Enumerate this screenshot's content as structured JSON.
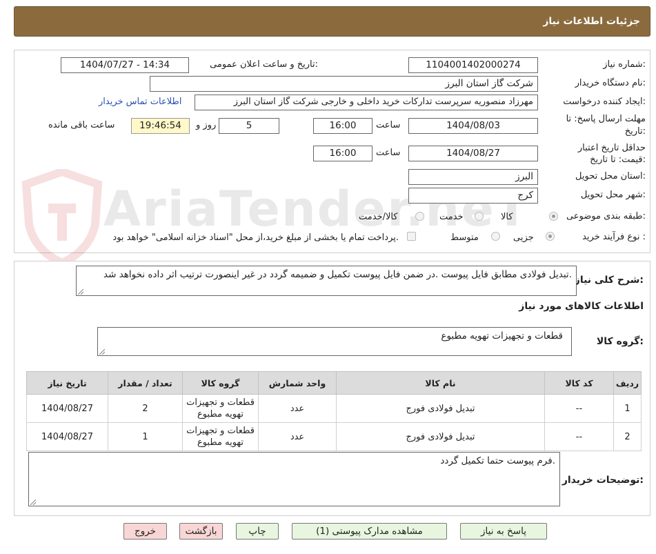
{
  "header": {
    "title": "جزئیات اطلاعات نیاز"
  },
  "details": {
    "need_number_label": "شماره نیاز:",
    "need_number": "1104001402000274",
    "announce_label": "تاریخ و ساعت اعلان عمومی:",
    "announce_value": "1404/07/27 - 14:34",
    "buyer_org_label": "نام دستگاه خریدار:",
    "buyer_org": "شرکت گاز استان البرز",
    "requester_label": "ایجاد کننده درخواست:",
    "requester": "مهرزاد منصوریه سرپرست تدارکات خرید داخلی و خارجی شرکت گاز استان البرز",
    "contact_link": "اطلاعات تماس خریدار",
    "deadline_label_1": "مهلت ارسال پاسخ: تا",
    "deadline_label_2": "تاریخ:",
    "deadline_date": "1404/08/03",
    "time_label": "ساعت",
    "deadline_time": "16:00",
    "days": "5",
    "days_label": "روز و",
    "remaining_time": "19:46:54",
    "remaining_label": "ساعت باقی مانده",
    "validity_label_1": "حداقل تاریخ اعتبار",
    "validity_label_2": "قیمت: تا تاریخ:",
    "validity_date": "1404/08/27",
    "validity_time": "16:00",
    "province_label": "استان محل تحویل:",
    "province": "البرز",
    "city_label": "شهر محل تحویل:",
    "city": "کرج",
    "category_label": "طبقه بندی موضوعی:",
    "category_options": [
      "کالا",
      "خدمت",
      "کالا/خدمت"
    ],
    "category_selected": "کالا",
    "process_label": "نوع فرآیند خرید :",
    "process_options": [
      "جزیی",
      "متوسط"
    ],
    "process_selected": "جزیی",
    "payment_note": "پرداخت تمام یا بخشی از مبلغ خرید،از محل \"اسناد خزانه اسلامی\" خواهد بود."
  },
  "summary": {
    "label": "شرح کلی نیاز:",
    "text": "تبدیل فولادی مطابق فایل پیوست .در ضمن فایل پیوست تکمیل و ضمیمه گردد در غیر اینصورت ترتیب اثر داده نخواهد شد."
  },
  "goods": {
    "section_title": "اطلاعات کالاهای مورد نیاز",
    "group_label": "گروه کالا:",
    "group_value": "قطعات و تجهیزات تهویه مطبوع",
    "columns": [
      "ردیف",
      "کد کالا",
      "نام کالا",
      "واحد شمارش",
      "گروه کالا",
      "تعداد / مقدار",
      "تاریخ نیاز"
    ],
    "rows": [
      [
        "1",
        "--",
        "تبدیل فولادی فورج",
        "عدد",
        "قطعات و تجهیزات تهویه مطبوع",
        "2",
        "1404/08/27"
      ],
      [
        "2",
        "--",
        "تبدیل فولادی فورج",
        "عدد",
        "قطعات و تجهیزات تهویه مطبوع",
        "1",
        "1404/08/27"
      ]
    ]
  },
  "buyer_notes": {
    "label": "توضیحات خریدار:",
    "text": "فرم پیوست حتما تکمیل گردد."
  },
  "buttons": {
    "reply": "پاسخ به نیاز",
    "attachments": "مشاهده مدارک پیوستی (1)",
    "print": "چاپ",
    "back": "بازگشت",
    "exit": "خروج"
  },
  "watermark": {
    "text": "AriaTender.neT"
  },
  "colors": {
    "header_bg": "#8b6b3e",
    "timer_bg": "#fff8c8",
    "link": "#2a4fb5",
    "green_btn": "#e8f6df",
    "pink_btn": "#f9d6d6"
  },
  "icons": {
    "watermark_logo": "shield-logo-icon",
    "resize": "resize-grip-icon"
  }
}
